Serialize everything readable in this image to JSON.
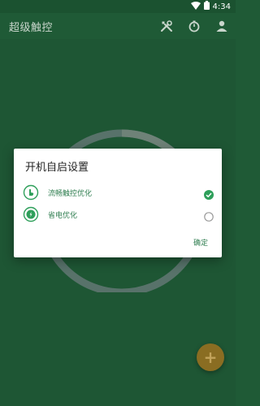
{
  "status_bar": {
    "time": "4:34"
  },
  "app_bar": {
    "title": "超级触控",
    "actions": [
      {
        "icon": "tools-icon"
      },
      {
        "icon": "timer-icon"
      },
      {
        "icon": "profile-icon"
      }
    ]
  },
  "dialog": {
    "title": "开机自启设置",
    "options": [
      {
        "label": "流畅触控优化",
        "icon": "touch-hand-icon",
        "selected": true
      },
      {
        "label": "省电优化",
        "icon": "power-save-icon",
        "selected": false
      }
    ],
    "confirm_label": "确定"
  },
  "fab": {
    "icon": "plus-icon",
    "label": "+"
  },
  "colors": {
    "background": "#1f5a36",
    "accent": "#2e9f5a",
    "ring": "#8a9a90",
    "fab": "#8a6d22"
  }
}
